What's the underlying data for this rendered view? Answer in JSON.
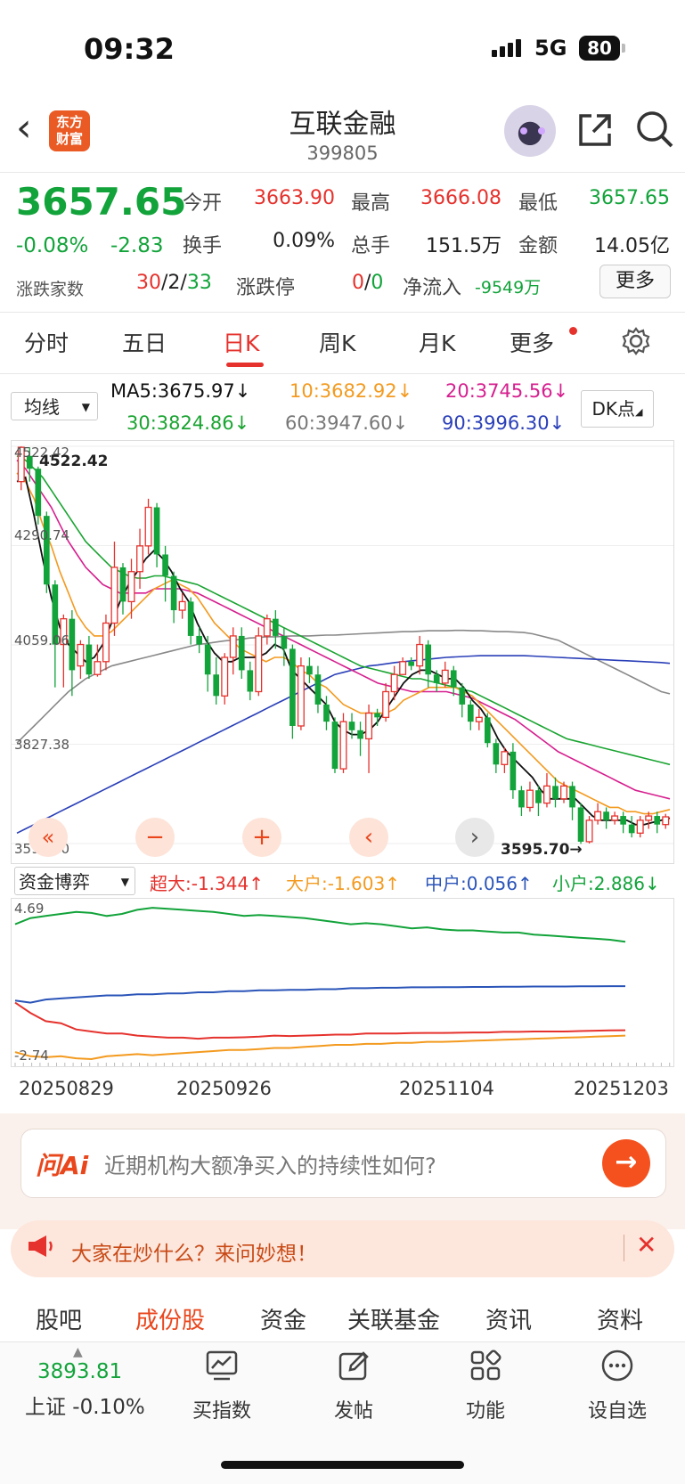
{
  "status_bar": {
    "time": "09:32",
    "network": "5G",
    "battery": "80"
  },
  "header": {
    "logo_text_1": "东方",
    "logo_text_2": "财富",
    "title": "互联金融",
    "code": "399805"
  },
  "quote": {
    "price": "3657.65",
    "change_pct": "-0.08%",
    "change": "-2.83",
    "rows": [
      [
        {
          "label": "今开",
          "value": "3663.90",
          "color": "red"
        },
        {
          "label": "最高",
          "value": "3666.08",
          "color": "red"
        },
        {
          "label": "最低",
          "value": "3657.65",
          "color": "green"
        }
      ],
      [
        {
          "label": "换手",
          "value": "0.09%",
          "color": "plain"
        },
        {
          "label": "总手",
          "value": "151.5万",
          "color": "plain"
        },
        {
          "label": "金额",
          "value": "14.05亿",
          "color": "plain"
        }
      ]
    ],
    "breadth_label": "涨跌家数",
    "breadth_up": "30",
    "breadth_flat": "2",
    "breadth_down": "33",
    "limit_label": "涨跌停",
    "limit_up": "0",
    "limit_down": "0",
    "net_inflow_label": "净流入",
    "net_inflow_value": "-9549万",
    "more_button": "更多"
  },
  "tabs": [
    "分时",
    "五日",
    "日K",
    "周K",
    "月K",
    "更多"
  ],
  "active_tab": "日K",
  "ma": {
    "selector": "均线",
    "ma5": "MA5:3675.97↓",
    "ma10": "10:3682.92↓",
    "ma20": "20:3745.56↓",
    "ma30": "30:3824.86↓",
    "ma60": "60:3947.60↓",
    "ma90": "90:3996.30↓",
    "dk_button": "DK点",
    "colors": {
      "ma5": "#111111",
      "ma10": "#f39a1f",
      "ma20": "#d61f8f",
      "ma30": "#1aa431",
      "ma60": "#888888",
      "ma90": "#2a3fb8"
    }
  },
  "chart_data": {
    "type": "candlestick",
    "ylim": [
      3595.7,
      4522.42
    ],
    "y_ticks": [
      "4522.42",
      "4290.74",
      "4059.06",
      "3827.38",
      "3595.70"
    ],
    "high_label": "4522.42",
    "low_label": "3595.70→",
    "dates": [
      "20250829",
      "20250926",
      "20251104",
      "20251203"
    ],
    "candles": [
      [
        4440,
        4520,
        4420,
        4522
      ],
      [
        4500,
        4470,
        4440,
        4520
      ],
      [
        4470,
        4360,
        4340,
        4475
      ],
      [
        4360,
        4200,
        4180,
        4370
      ],
      [
        4200,
        4060,
        3960,
        4210
      ],
      [
        4060,
        4120,
        3960,
        4130
      ],
      [
        4120,
        4000,
        3940,
        4140
      ],
      [
        4010,
        4060,
        3980,
        4070
      ],
      [
        4060,
        3990,
        3980,
        4080
      ],
      [
        3990,
        4020,
        3985,
        4060
      ],
      [
        4020,
        4110,
        4000,
        4130
      ],
      [
        4110,
        4240,
        4080,
        4300
      ],
      [
        4240,
        4160,
        4130,
        4250
      ],
      [
        4160,
        4230,
        4120,
        4260
      ],
      [
        4230,
        4290,
        4190,
        4330
      ],
      [
        4290,
        4380,
        4270,
        4400
      ],
      [
        4380,
        4270,
        4240,
        4390
      ],
      [
        4270,
        4220,
        4160,
        4290
      ],
      [
        4220,
        4140,
        4110,
        4230
      ],
      [
        4140,
        4160,
        4120,
        4180
      ],
      [
        4160,
        4080,
        4060,
        4170
      ],
      [
        4080,
        4060,
        4040,
        4100
      ],
      [
        4060,
        3990,
        3950,
        4080
      ],
      [
        3990,
        3940,
        3920,
        4030
      ],
      [
        3940,
        4030,
        3920,
        4040
      ],
      [
        4030,
        4080,
        3990,
        4100
      ],
      [
        4080,
        4000,
        3980,
        4100
      ],
      [
        4000,
        3950,
        3930,
        4020
      ],
      [
        3950,
        4080,
        3940,
        4100
      ],
      [
        4080,
        4120,
        4060,
        4130
      ],
      [
        4120,
        4080,
        4050,
        4140
      ],
      [
        4080,
        4050,
        4010,
        4100
      ],
      [
        4050,
        3870,
        3840,
        4060
      ],
      [
        3870,
        4010,
        3860,
        4030
      ],
      [
        4010,
        3990,
        3970,
        4030
      ],
      [
        3990,
        3920,
        3900,
        4010
      ],
      [
        3920,
        3880,
        3860,
        3940
      ],
      [
        3880,
        3770,
        3760,
        3890
      ],
      [
        3770,
        3880,
        3760,
        3900
      ],
      [
        3880,
        3860,
        3840,
        3900
      ],
      [
        3860,
        3840,
        3800,
        3880
      ],
      [
        3840,
        3900,
        3760,
        3920
      ],
      [
        3900,
        3890,
        3870,
        3910
      ],
      [
        3890,
        3950,
        3880,
        3970
      ],
      [
        3950,
        3990,
        3930,
        4010
      ],
      [
        3990,
        4020,
        3990,
        4030
      ],
      [
        4020,
        4010,
        4000,
        4030
      ],
      [
        4010,
        4060,
        3990,
        4080
      ],
      [
        4060,
        3990,
        3960,
        4070
      ],
      [
        3990,
        3970,
        3950,
        4000
      ],
      [
        3970,
        4000,
        3960,
        4020
      ],
      [
        4000,
        3960,
        3940,
        4010
      ],
      [
        3960,
        3920,
        3890,
        3970
      ],
      [
        3920,
        3880,
        3860,
        3930
      ],
      [
        3880,
        3890,
        3860,
        3910
      ],
      [
        3890,
        3830,
        3820,
        3900
      ],
      [
        3830,
        3780,
        3760,
        3840
      ],
      [
        3780,
        3810,
        3760,
        3820
      ],
      [
        3810,
        3720,
        3700,
        3830
      ],
      [
        3720,
        3680,
        3660,
        3730
      ],
      [
        3680,
        3720,
        3670,
        3740
      ],
      [
        3720,
        3690,
        3660,
        3730
      ],
      [
        3690,
        3730,
        3680,
        3760
      ],
      [
        3730,
        3700,
        3680,
        3750
      ],
      [
        3700,
        3730,
        3690,
        3740
      ],
      [
        3730,
        3680,
        3650,
        3740
      ],
      [
        3680,
        3600,
        3595,
        3690
      ],
      [
        3600,
        3650,
        3596,
        3660
      ],
      [
        3650,
        3670,
        3640,
        3690
      ],
      [
        3670,
        3650,
        3630,
        3680
      ],
      [
        3650,
        3660,
        3640,
        3670
      ],
      [
        3660,
        3640,
        3620,
        3670
      ],
      [
        3640,
        3620,
        3610,
        3660
      ],
      [
        3620,
        3650,
        3610,
        3660
      ],
      [
        3650,
        3660,
        3630,
        3670
      ],
      [
        3660,
        3640,
        3620,
        3670
      ],
      [
        3640,
        3658,
        3630,
        3665
      ]
    ],
    "ma_series": {
      "ma5": [
        4440,
        4450,
        4360,
        4260,
        4170,
        4100,
        4060,
        4040,
        4020,
        4030,
        4060,
        4110,
        4160,
        4200,
        4230,
        4260,
        4280,
        4260,
        4230,
        4190,
        4160,
        4110,
        4070,
        4040,
        4020,
        4020,
        4030,
        4030,
        4030,
        4040,
        4060,
        4050,
        4000,
        3980,
        3960,
        3940,
        3920,
        3880,
        3860,
        3850,
        3850,
        3860,
        3880,
        3910,
        3940,
        3970,
        3990,
        4000,
        4000,
        3990,
        3980,
        3980,
        3960,
        3930,
        3910,
        3880,
        3840,
        3810,
        3790,
        3770,
        3750,
        3720,
        3700,
        3700,
        3700,
        3700,
        3680,
        3660,
        3650,
        3650,
        3650,
        3650,
        3640,
        3640,
        3645,
        3650,
        3655
      ],
      "ma10": [
        4460,
        4440,
        4400,
        4340,
        4290,
        4230,
        4180,
        4130,
        4100,
        4080,
        4080,
        4090,
        4110,
        4130,
        4150,
        4170,
        4190,
        4200,
        4210,
        4200,
        4190,
        4170,
        4140,
        4110,
        4090,
        4070,
        4050,
        4040,
        4030,
        4020,
        4030,
        4030,
        4020,
        4000,
        3990,
        3970,
        3960,
        3940,
        3920,
        3910,
        3900,
        3900,
        3900,
        3900,
        3910,
        3930,
        3940,
        3950,
        3960,
        3960,
        3960,
        3960,
        3950,
        3940,
        3920,
        3900,
        3880,
        3860,
        3840,
        3820,
        3800,
        3780,
        3760,
        3740,
        3730,
        3720,
        3710,
        3700,
        3690,
        3680,
        3680,
        3670,
        3670,
        3665,
        3665,
        3670,
        3675
      ],
      "ma20": [
        4490,
        4470,
        4440,
        4410,
        4380,
        4340,
        4300,
        4270,
        4240,
        4220,
        4200,
        4190,
        4180,
        4180,
        4180,
        4180,
        4190,
        4190,
        4190,
        4190,
        4185,
        4180,
        4170,
        4160,
        4150,
        4140,
        4130,
        4120,
        4110,
        4100,
        4090,
        4080,
        4070,
        4060,
        4050,
        4040,
        4030,
        4020,
        4010,
        4000,
        3990,
        3980,
        3970,
        3965,
        3960,
        3955,
        3950,
        3950,
        3950,
        3950,
        3950,
        3945,
        3940,
        3935,
        3925,
        3915,
        3905,
        3895,
        3885,
        3870,
        3855,
        3840,
        3825,
        3810,
        3800,
        3790,
        3780,
        3770,
        3760,
        3750,
        3740,
        3730,
        3720,
        3715,
        3710,
        3705,
        3700
      ],
      "ma30": [
        4500,
        4490,
        4470,
        4450,
        4420,
        4390,
        4360,
        4330,
        4300,
        4280,
        4260,
        4240,
        4230,
        4220,
        4215,
        4215,
        4220,
        4220,
        4215,
        4210,
        4205,
        4200,
        4190,
        4180,
        4170,
        4160,
        4150,
        4140,
        4130,
        4120,
        4110,
        4100,
        4090,
        4080,
        4070,
        4060,
        4050,
        4040,
        4030,
        4020,
        4010,
        4005,
        4000,
        3995,
        3990,
        3985,
        3980,
        3980,
        3975,
        3970,
        3965,
        3960,
        3955,
        3950,
        3940,
        3930,
        3920,
        3910,
        3900,
        3890,
        3880,
        3870,
        3860,
        3850,
        3840,
        3835,
        3830,
        3825,
        3820,
        3815,
        3810,
        3805,
        3800,
        3795,
        3790,
        3785,
        3780
      ],
      "ma60": [
        3830,
        3850,
        3870,
        3890,
        3910,
        3930,
        3950,
        3965,
        3980,
        3990,
        4000,
        4010,
        4015,
        4020,
        4025,
        4030,
        4035,
        4040,
        4045,
        4050,
        4055,
        4060,
        4062,
        4065,
        4068,
        4070,
        4072,
        4075,
        4076,
        4078,
        4078,
        4079,
        4080,
        4080,
        4080,
        4081,
        4082,
        4082,
        4083,
        4084,
        4085,
        4086,
        4087,
        4088,
        4089,
        4090,
        4090,
        4091,
        4092,
        4092,
        4092,
        4093,
        4093,
        4092,
        4092,
        4091,
        4090,
        4090,
        4089,
        4088,
        4085,
        4080,
        4075,
        4070,
        4060,
        4050,
        4040,
        4030,
        4020,
        4010,
        4000,
        3990,
        3980,
        3970,
        3960,
        3950,
        3945
      ],
      "ma90": [
        3620,
        3630,
        3640,
        3650,
        3660,
        3670,
        3680,
        3690,
        3700,
        3710,
        3720,
        3730,
        3740,
        3750,
        3760,
        3770,
        3780,
        3790,
        3800,
        3810,
        3820,
        3830,
        3840,
        3850,
        3860,
        3870,
        3880,
        3890,
        3900,
        3910,
        3920,
        3930,
        3940,
        3950,
        3960,
        3970,
        3980,
        3990,
        3995,
        4000,
        4005,
        4010,
        4012,
        4015,
        4018,
        4020,
        4022,
        4024,
        4026,
        4028,
        4030,
        4031,
        4032,
        4033,
        4034,
        4034,
        4034,
        4034,
        4034,
        4034,
        4033,
        4032,
        4031,
        4030,
        4029,
        4028,
        4027,
        4026,
        4025,
        4024,
        4023,
        4022,
        4021,
        4020,
        4019,
        4018,
        4016
      ]
    }
  },
  "capital": {
    "selector": "资金博弈",
    "super": "超大:-1.344↑",
    "large": "大户:-1.603↑",
    "medium": "中户:0.056↑",
    "small": "小户:2.886↓",
    "ylim": [
      -2.74,
      4.69
    ],
    "y_top": "4.69",
    "y_bottom": "-2.74",
    "series": {
      "small": [
        3.8,
        4.1,
        4.2,
        4.3,
        4.4,
        4.35,
        4.2,
        4.3,
        4.5,
        4.6,
        4.55,
        4.5,
        4.45,
        4.4,
        4.3,
        4.2,
        4.25,
        4.2,
        4.15,
        4.1,
        4.0,
        3.9,
        3.8,
        3.85,
        3.8,
        3.7,
        3.6,
        3.65,
        3.55,
        3.5,
        3.5,
        3.45,
        3.4,
        3.4,
        3.3,
        3.25,
        3.2,
        3.15,
        3.1,
        3.05,
        2.95
      ],
      "medium": [
        0.1,
        0.0,
        0.15,
        0.2,
        0.25,
        0.3,
        0.35,
        0.35,
        0.4,
        0.4,
        0.45,
        0.45,
        0.5,
        0.5,
        0.55,
        0.55,
        0.6,
        0.6,
        0.62,
        0.62,
        0.65,
        0.65,
        0.7,
        0.7,
        0.72,
        0.72,
        0.74,
        0.74,
        0.75,
        0.75,
        0.76,
        0.76,
        0.77,
        0.77,
        0.78,
        0.78,
        0.78,
        0.79,
        0.79,
        0.8,
        0.8
      ],
      "super": [
        0.0,
        -0.5,
        -0.9,
        -1.0,
        -1.3,
        -1.4,
        -1.5,
        -1.5,
        -1.6,
        -1.65,
        -1.7,
        -1.7,
        -1.75,
        -1.7,
        -1.7,
        -1.68,
        -1.65,
        -1.6,
        -1.62,
        -1.6,
        -1.58,
        -1.55,
        -1.55,
        -1.5,
        -1.5,
        -1.5,
        -1.48,
        -1.47,
        -1.47,
        -1.46,
        -1.45,
        -1.45,
        -1.42,
        -1.42,
        -1.4,
        -1.4,
        -1.4,
        -1.38,
        -1.36,
        -1.35,
        -1.34
      ],
      "large": [
        -2.4,
        -2.6,
        -2.65,
        -2.6,
        -2.7,
        -2.74,
        -2.6,
        -2.55,
        -2.5,
        -2.55,
        -2.5,
        -2.45,
        -2.4,
        -2.35,
        -2.3,
        -2.3,
        -2.25,
        -2.2,
        -2.2,
        -2.15,
        -2.1,
        -2.05,
        -2.05,
        -2.0,
        -2.0,
        -1.95,
        -1.95,
        -1.9,
        -1.9,
        -1.88,
        -1.85,
        -1.83,
        -1.8,
        -1.78,
        -1.75,
        -1.73,
        -1.7,
        -1.68,
        -1.65,
        -1.63,
        -1.6
      ]
    },
    "colors": {
      "super": "#e5322d",
      "large": "#f39a1f",
      "medium": "#2a54b8",
      "small": "#12a33a"
    }
  },
  "ai": {
    "logo": "问Ai",
    "prompt": "近期机构大额净买入的持续性如何?"
  },
  "banner": {
    "text": "大家在炒什么？来问妙想！",
    "close": "✕"
  },
  "bottom_tabs": [
    "股吧",
    "成份股",
    "资金",
    "关联基金",
    "资讯",
    "资料"
  ],
  "active_bottom_tab": "成份股",
  "footer": {
    "index_value": "3893.81",
    "index_label": "上证 -0.10%",
    "items": [
      {
        "label": "买指数",
        "icon": "chart-icon"
      },
      {
        "label": "发帖",
        "icon": "edit-icon"
      },
      {
        "label": "功能",
        "icon": "grid-icon"
      },
      {
        "label": "设自选",
        "icon": "more-dots-icon"
      }
    ]
  }
}
